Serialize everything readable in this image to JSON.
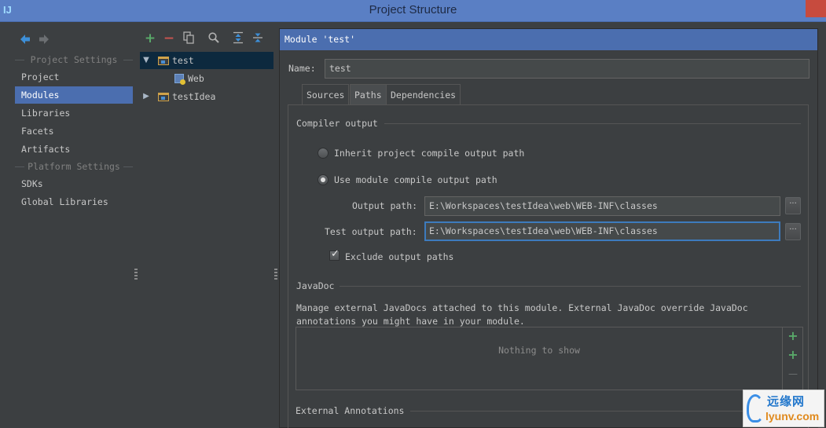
{
  "window": {
    "title": "Project Structure",
    "app_icon": "IJ"
  },
  "sidebar": {
    "back_icon": "arrow-left-icon",
    "forward_icon": "arrow-right-icon",
    "project_settings_label": "Project Settings",
    "project_items": [
      "Project",
      "Modules",
      "Libraries",
      "Facets",
      "Artifacts"
    ],
    "platform_settings_label": "Platform Settings",
    "platform_items": [
      "SDKs",
      "Global Libraries"
    ],
    "selected": "Modules"
  },
  "tree": {
    "toolbar": {
      "add": "+",
      "remove": "−",
      "copy_icon": "copy-icon",
      "find_icon": "search-icon",
      "expand_icon": "expand-all-icon",
      "collapse_icon": "collapse-all-icon"
    },
    "nodes": [
      {
        "label": "test",
        "expanded": true,
        "selected": true
      },
      {
        "label": "Web"
      },
      {
        "label": "testIdea",
        "expanded": false
      }
    ],
    "expanded_arrow": "▼",
    "collapsed_arrow": "▶"
  },
  "module": {
    "header": "Module 'test'",
    "name_label": "Name:",
    "name_value": "test",
    "tabs": [
      "Sources",
      "Paths",
      "Dependencies"
    ],
    "active_tab": "Paths",
    "compiler_output": {
      "title": "Compiler output",
      "inherit_label": "Inherit project compile output path",
      "use_module_label": "Use module compile output path",
      "selected_option": "use_module",
      "output_path_label": "Output path:",
      "output_path_value": "E:\\Workspaces\\testIdea\\web\\WEB-INF\\classes",
      "test_output_path_label": "Test output path:",
      "test_output_path_value": "E:\\Workspaces\\testIdea\\web\\WEB-INF\\classes",
      "browse_label": "···",
      "exclude_label": "Exclude output paths",
      "exclude_checked": true
    },
    "javadoc": {
      "title": "JavaDoc",
      "description_line1": "Manage external JavaDocs attached to this module. External JavaDoc override JavaDoc",
      "description_line2": "annotations you might have in your module.",
      "empty_text": "Nothing to show",
      "add": "+",
      "add_url": "+",
      "remove": "—"
    },
    "external_annotations": {
      "title": "External Annotations"
    }
  },
  "watermark": {
    "line1": "远缘网",
    "line2": "lyunv.com"
  },
  "colors": {
    "selection": "#4b6eaf",
    "tree_selection": "#0d293e",
    "add_green": "#59a869",
    "remove_red": "#c75450",
    "focus_border": "#3d7bbd"
  }
}
